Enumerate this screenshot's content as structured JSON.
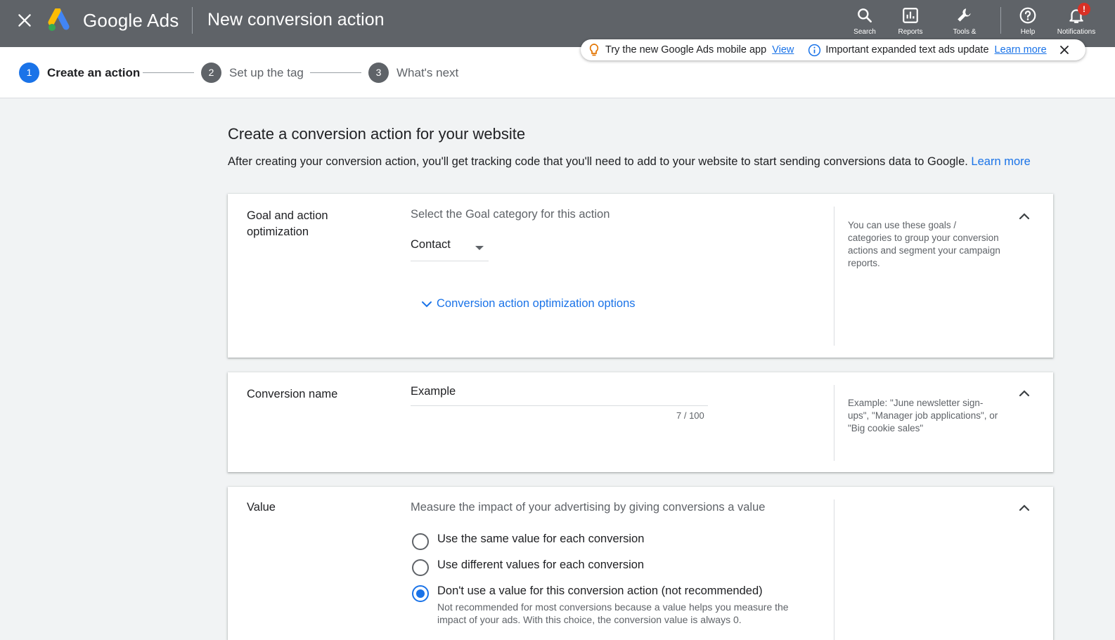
{
  "colors": {
    "header_bg": "#5f6368",
    "accent": "#1a73e8",
    "step_inactive": "#5f6368",
    "badge": "#d93025"
  },
  "header": {
    "brand": "Google Ads",
    "title": "New conversion action",
    "tools": {
      "search": "Search",
      "reports": "Reports",
      "tools": "Tools &",
      "help": "Help",
      "notifications": "Notifications",
      "notifications_badge": "!"
    }
  },
  "announcement": {
    "mobile_text": "Try the new Google Ads mobile app",
    "mobile_link": "View",
    "update_text": "Important expanded text ads update",
    "update_link": "Learn more"
  },
  "stepper": {
    "steps": [
      {
        "number": "1",
        "label": "Create an action"
      },
      {
        "number": "2",
        "label": "Set up the tag"
      },
      {
        "number": "3",
        "label": "What's next"
      }
    ]
  },
  "main": {
    "title": "Create a conversion action for your website",
    "intro": "After creating your conversion action, you'll get tracking code that you'll need to add to your website to start sending conversions data to Google.",
    "intro_link": "Learn more"
  },
  "goal_card": {
    "label": "Goal and action optimization",
    "hint": "Select the Goal category for this action",
    "selected": "Contact",
    "expander": "Conversion action optimization options",
    "help": "You can use these goals / categories to group your conversion actions and segment your campaign reports."
  },
  "name_card": {
    "label": "Conversion name",
    "value": "Example",
    "counter": "7 / 100",
    "help": "Example: \"June newsletter sign-ups\", \"Manager job applications\", or \"Big cookie sales\""
  },
  "value_card": {
    "label": "Value",
    "hint": "Measure the impact of your advertising by giving conversions a value",
    "options": [
      {
        "label": "Use the same value for each conversion",
        "selected": false
      },
      {
        "label": "Use different values for each conversion",
        "selected": false
      },
      {
        "label": "Don't use a value for this conversion action (not recommended)",
        "selected": true,
        "sub": "Not recommended for most conversions because a value helps you measure the impact of your ads. With this choice, the conversion value is always 0."
      }
    ]
  }
}
